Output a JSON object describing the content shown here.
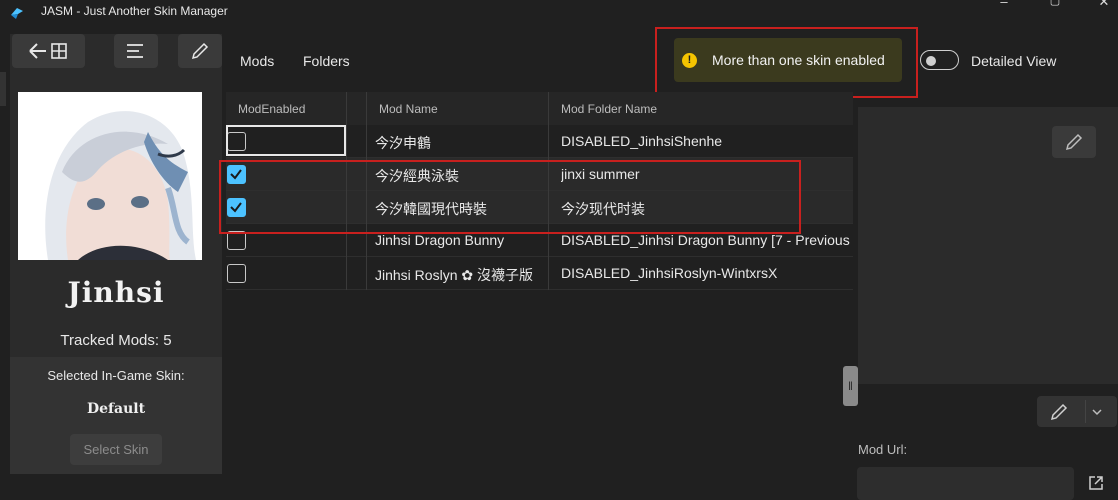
{
  "window": {
    "title": "JASM - Just Another Skin Manager"
  },
  "character": {
    "name": "Jinhsi",
    "tracked_mods": "Tracked Mods: 5",
    "selected_skin_label": "Selected In-Game Skin:",
    "selected_skin_value": "Default",
    "select_skin_button": "Select Skin"
  },
  "nav": {
    "tabs": [
      "Mods",
      "Folders"
    ]
  },
  "toast": {
    "message": "More than one skin enabled",
    "icon": "warning-icon",
    "color": "#f5c400"
  },
  "detailed_view": {
    "label": "Detailed View",
    "on": false
  },
  "table": {
    "columns": [
      "ModEnabled",
      "Mod Name",
      "Mod Folder Name"
    ],
    "rows": [
      {
        "enabled": false,
        "name": "今汐申鶴",
        "folder": "DISABLED_JinhsiShenhe"
      },
      {
        "enabled": true,
        "name": "今汐經典泳裝",
        "folder": "jinxi summer"
      },
      {
        "enabled": true,
        "name": "今汐韓國現代時裝",
        "folder": "今汐现代时装"
      },
      {
        "enabled": false,
        "name": "Jinhsi Dragon Bunny",
        "folder": "DISABLED_Jinhsi Dragon Bunny [7 - Previous"
      },
      {
        "enabled": false,
        "name": "Jinhsi Roslyn ✿ 沒襪子版",
        "folder": "DISABLED_JinhsiRoslyn-WintxrsX"
      }
    ]
  },
  "details": {
    "mod_url_label": "Mod Url:",
    "mod_url_value": ""
  },
  "colors": {
    "accent": "#4cc2ff",
    "highlight_box": "#c8201e",
    "background": "#202020"
  }
}
